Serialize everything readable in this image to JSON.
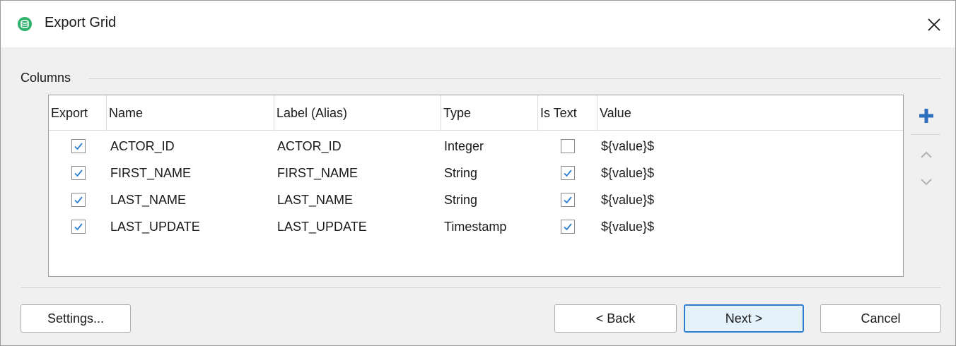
{
  "window": {
    "title": "Export Grid",
    "app_icon": "database-export-icon",
    "close_icon": "close-icon"
  },
  "columns_group": {
    "label": "Columns"
  },
  "table": {
    "headers": [
      "Export",
      "Name",
      "Label (Alias)",
      "Type",
      "Is Text",
      "Value"
    ],
    "rows": [
      {
        "export": true,
        "name": "ACTOR_ID",
        "label": "ACTOR_ID",
        "type": "Integer",
        "is_text": false,
        "value": "${value}$"
      },
      {
        "export": true,
        "name": "FIRST_NAME",
        "label": "FIRST_NAME",
        "type": "String",
        "is_text": true,
        "value": "${value}$"
      },
      {
        "export": true,
        "name": "LAST_NAME",
        "label": "LAST_NAME",
        "type": "String",
        "is_text": true,
        "value": "${value}$"
      },
      {
        "export": true,
        "name": "LAST_UPDATE",
        "label": "LAST_UPDATE",
        "type": "Timestamp",
        "is_text": true,
        "value": "${value}$"
      }
    ]
  },
  "side_toolbar": {
    "add_icon": "plus-icon",
    "up_icon": "chevron-up-icon",
    "down_icon": "chevron-down-icon",
    "add_color": "#2d6fbd",
    "disabled_color": "#b5b5b5"
  },
  "buttons": {
    "settings": "Settings...",
    "back": "< Back",
    "next": "Next >",
    "cancel": "Cancel"
  },
  "colors": {
    "accent": "#2d7ed1",
    "check": "#2d7ed1",
    "app_icon": "#2fb36c"
  }
}
